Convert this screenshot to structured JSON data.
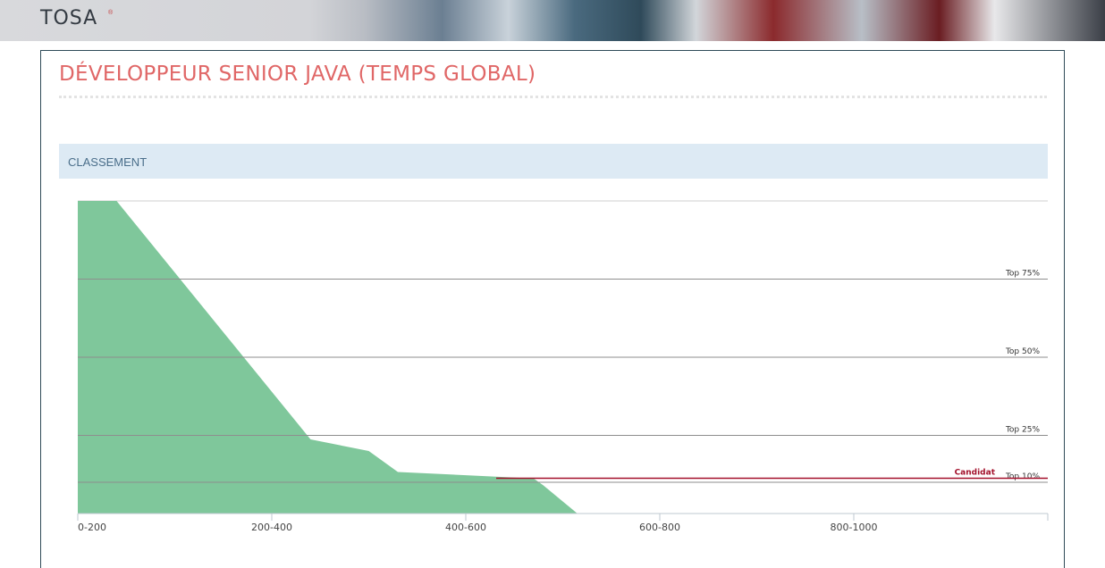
{
  "header": {
    "logo_text": "TOSA",
    "logo_mark": "®"
  },
  "page_title": "DÉVELOPPEUR SENIOR JAVA (TEMPS GLOBAL)",
  "section": {
    "label": "CLASSEMENT"
  },
  "colors": {
    "area": "#7fc79b",
    "candidate": "#a3102b",
    "title": "#e06767",
    "section_bg": "#ddeaf4"
  },
  "chart_data": {
    "type": "area",
    "x_ticks": [
      "0-200",
      "200-400",
      "400-600",
      "600-800",
      "800-1000"
    ],
    "x": [
      0,
      40,
      240,
      300,
      330,
      470,
      480,
      515
    ],
    "y": [
      100,
      100,
      23.7,
      20,
      13.3,
      11.2,
      9,
      0
    ],
    "ylim": [
      0,
      100
    ],
    "thresholds": [
      {
        "label": "Top 75%",
        "value": 75
      },
      {
        "label": "Top 50%",
        "value": 50
      },
      {
        "label": "Top 25%",
        "value": 25
      },
      {
        "label": "Top 10%",
        "value": 10
      }
    ],
    "candidate": {
      "label": "Candidat",
      "value": 11
    },
    "grid": true
  }
}
